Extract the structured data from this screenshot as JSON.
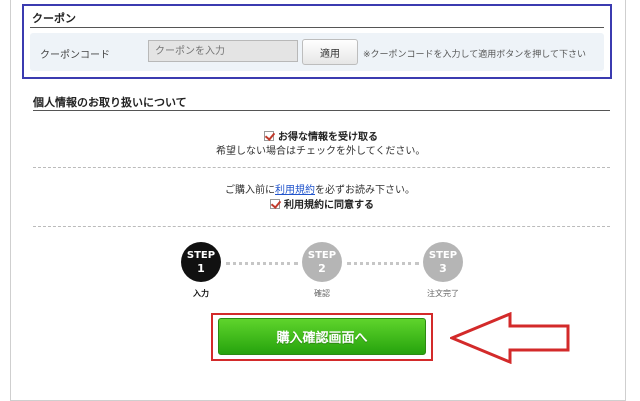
{
  "coupon": {
    "title": "クーポン",
    "label": "クーポンコード",
    "placeholder": "クーポンを入力",
    "apply_label": "適用",
    "note": "※クーポンコードを入力して適用ボタンを押して下さい"
  },
  "privacy": {
    "title": "個人情報のお取り扱いについて",
    "deals_checkbox": "お得な情報を受け取る",
    "deals_note": "希望しない場合はチェックを外してください。",
    "deals_checked": true
  },
  "terms": {
    "prefix": "ご購入前に",
    "link": "利用規約",
    "suffix": "を必ずお読み下さい。",
    "agree_checkbox": "利用規約に同意する",
    "agree_checked": true
  },
  "steps": [
    {
      "word": "STEP",
      "num": "1",
      "label": "入力",
      "active": true
    },
    {
      "word": "STEP",
      "num": "2",
      "label": "確認",
      "active": false
    },
    {
      "word": "STEP",
      "num": "3",
      "label": "注文完了",
      "active": false
    }
  ],
  "cta": {
    "label": "購入確認画面へ"
  },
  "colors": {
    "accent_green": "#26a30d",
    "highlight_red": "#d32a2a",
    "coupon_border": "#3b3bb0"
  }
}
